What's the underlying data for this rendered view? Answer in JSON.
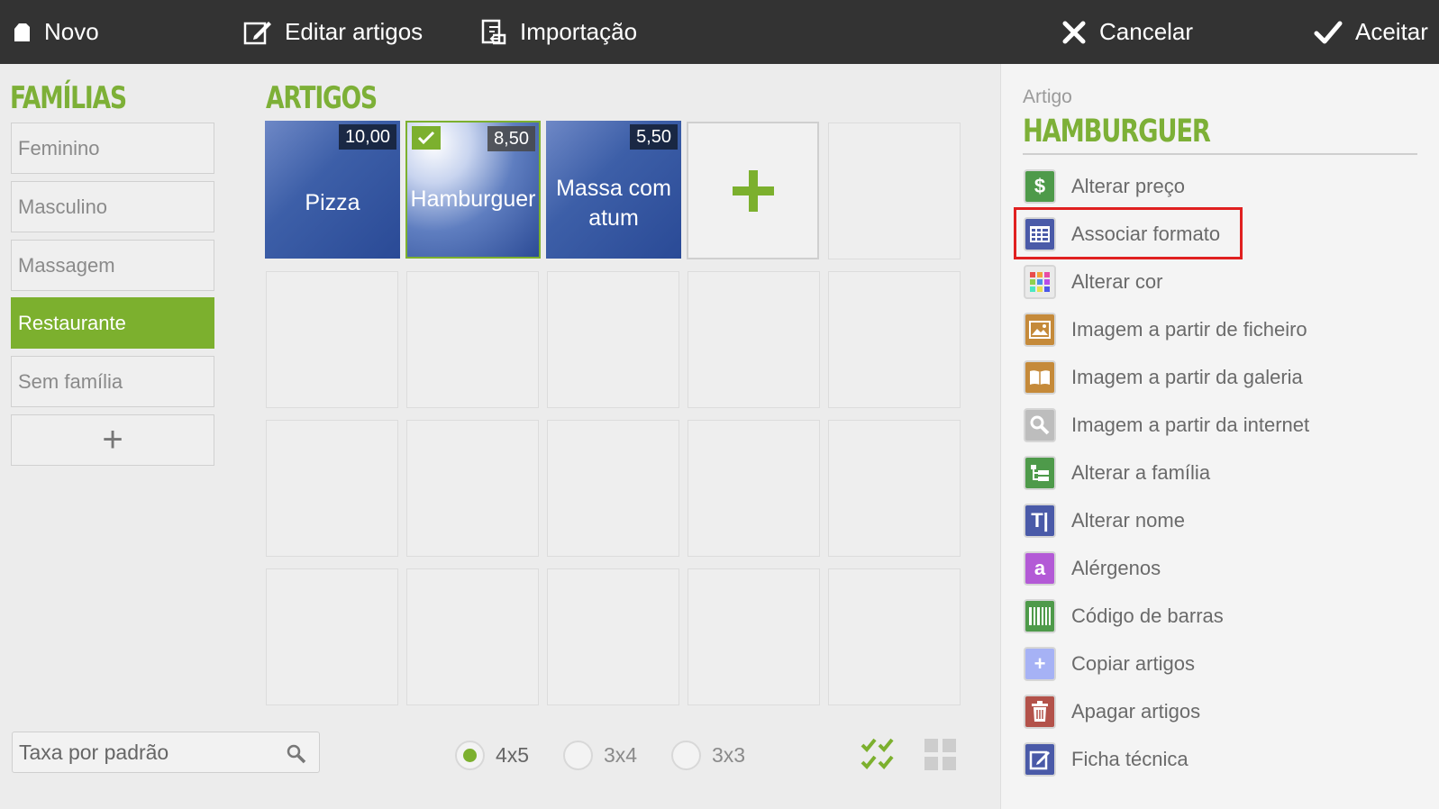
{
  "toolbar": {
    "new_label": "Novo",
    "edit_label": "Editar artigos",
    "import_label": "Importação",
    "cancel_label": "Cancelar",
    "accept_label": "Aceitar"
  },
  "families": {
    "title": "FAMÍLIAS",
    "items": [
      {
        "label": "Feminino",
        "active": false
      },
      {
        "label": "Masculino",
        "active": false
      },
      {
        "label": "Massagem",
        "active": false
      },
      {
        "label": "Restaurante",
        "active": true
      },
      {
        "label": "Sem família",
        "active": false
      }
    ],
    "add_label": "+"
  },
  "articles": {
    "title": "ARTIGOS",
    "items": [
      {
        "name": "Pizza",
        "price": "10,00",
        "selected": false
      },
      {
        "name": "Hamburguer",
        "price": "8,50",
        "selected": true
      },
      {
        "name": "Massa com atum",
        "price": "5,50",
        "selected": false
      }
    ],
    "tile_color": "#2f4f9c"
  },
  "search": {
    "placeholder": "Taxa por padrão"
  },
  "layout_options": {
    "options": [
      {
        "label": "4x5",
        "selected": true
      },
      {
        "label": "3x4",
        "selected": false
      },
      {
        "label": "3x3",
        "selected": false
      }
    ]
  },
  "panel": {
    "label": "Artigo",
    "title": "HAMBURGUER",
    "actions": [
      {
        "label": "Alterar preço",
        "icon": "dollar-icon",
        "color": "#4e9a4a"
      },
      {
        "label": "Associar formato",
        "icon": "grid-table-icon",
        "color": "#4a5aa8"
      },
      {
        "label": "Alterar cor",
        "icon": "color-palette-icon",
        "color": "#eaeaea"
      },
      {
        "label": "Imagem a partir de ficheiro",
        "icon": "image-file-icon",
        "color": "#c58a3a"
      },
      {
        "label": "Imagem a partir da galeria",
        "icon": "gallery-book-icon",
        "color": "#c58a3a"
      },
      {
        "label": "Imagem a partir da internet",
        "icon": "magnifier-icon",
        "color": "#bdbdbd"
      },
      {
        "label": "Alterar a família",
        "icon": "family-tree-icon",
        "color": "#4e9a4a"
      },
      {
        "label": "Alterar nome",
        "icon": "text-rename-icon",
        "color": "#4a5aa8"
      },
      {
        "label": "Alérgenos",
        "icon": "allergen-icon",
        "color": "#b35ad6"
      },
      {
        "label": "Código de barras",
        "icon": "barcode-icon",
        "color": "#4e9a4a"
      },
      {
        "label": "Copiar artigos",
        "icon": "copy-plus-icon",
        "color": "#a6b2f5"
      },
      {
        "label": "Apagar artigos",
        "icon": "trash-icon",
        "color": "#b3524a"
      },
      {
        "label": "Ficha técnica",
        "icon": "edit-sheet-icon",
        "color": "#4a5aa8"
      }
    ],
    "highlighted_action": "Associar formato"
  },
  "colors": {
    "accent_green": "#7cb02e",
    "topbar": "#333333",
    "highlight_red": "#e02020"
  }
}
